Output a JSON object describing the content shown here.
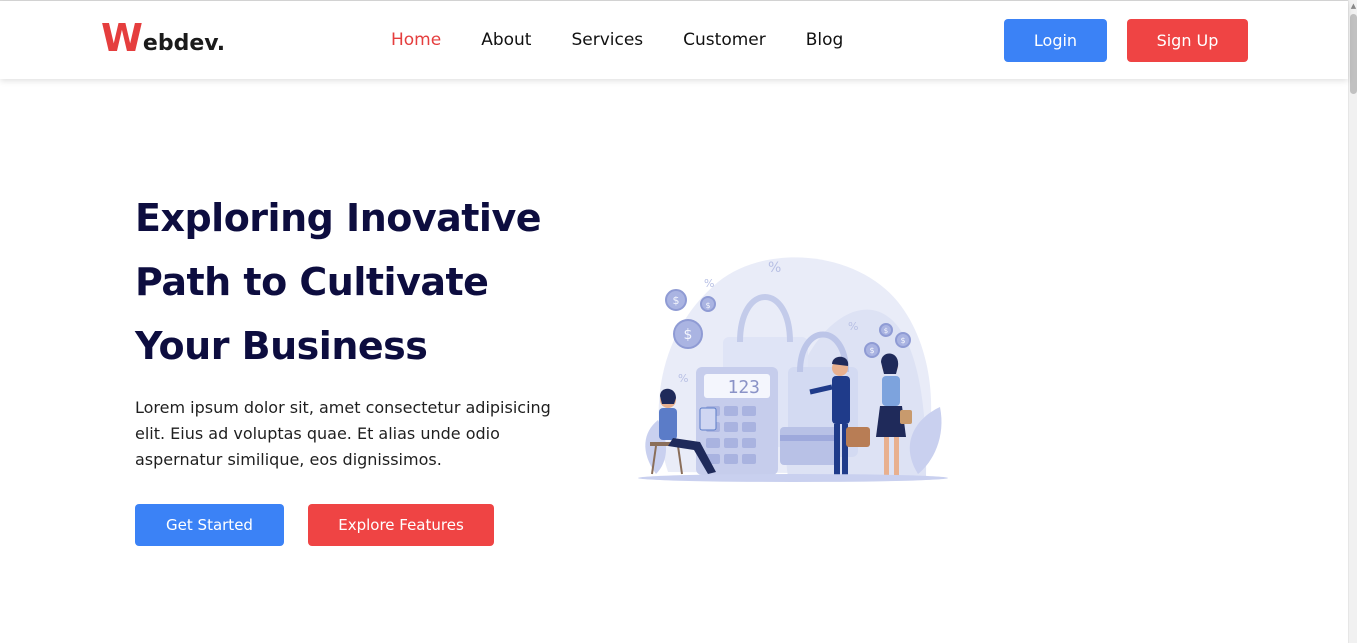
{
  "header": {
    "logo_first": "W",
    "logo_rest": "ebdev.",
    "nav": [
      {
        "label": "Home",
        "active": true
      },
      {
        "label": "About"
      },
      {
        "label": "Services"
      },
      {
        "label": "Customer"
      },
      {
        "label": "Blog"
      }
    ],
    "login_label": "Login",
    "signup_label": "Sign Up"
  },
  "hero": {
    "title_line1": "Exploring Inovative",
    "title_line2": "Path to Cultivate",
    "title_line3": "Your Business",
    "description": "Lorem ipsum dolor sit, amet consectetur adipisicing elit. Eius ad voluptas quae. Et alias unde odio aspernatur similique, eos dignissimos.",
    "primary_cta": "Get Started",
    "secondary_cta": "Explore Features",
    "illustration_calculator_display": "123"
  },
  "colors": {
    "accent_red": "#ef4444",
    "accent_blue": "#3b82f6",
    "heading_navy": "#0d0d3f"
  },
  "icons": {
    "illustration": "shopping-finance-illustration",
    "scroll_up": "scroll-up-arrow-icon"
  }
}
